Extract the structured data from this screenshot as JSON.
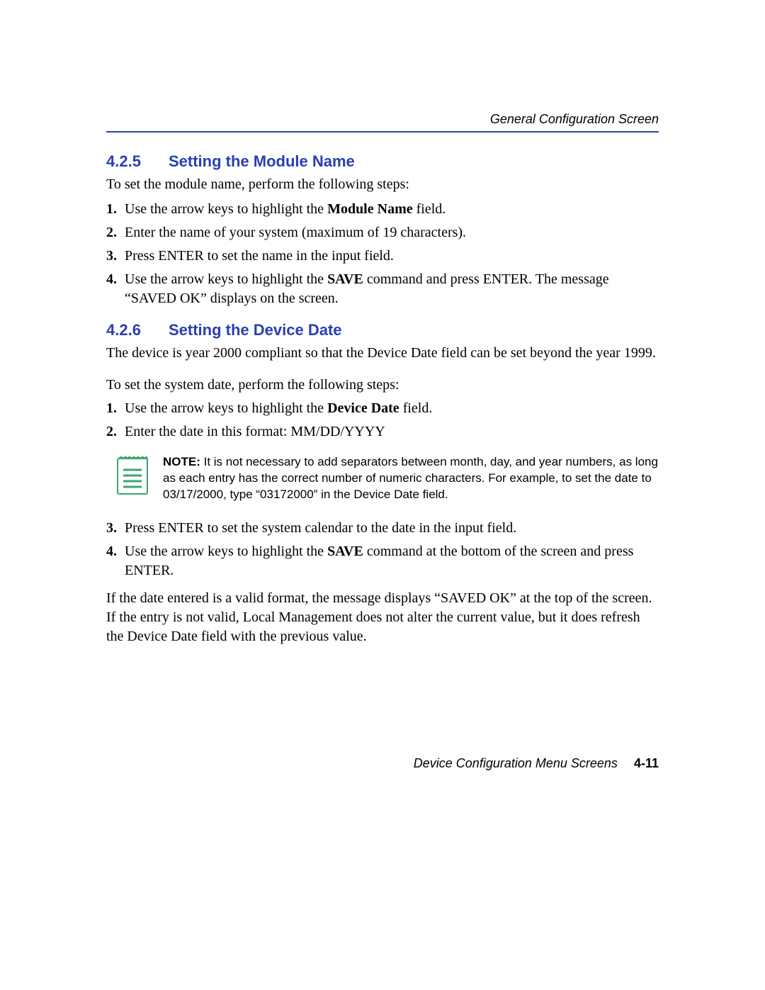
{
  "header": "General Configuration Screen",
  "section1": {
    "number": "4.2.5",
    "title": "Setting the Module Name",
    "intro": "To set the module name, perform the following steps:",
    "steps": {
      "s1_a": "Use the arrow keys to highlight the ",
      "s1_bold": "Module Name",
      "s1_b": " field.",
      "s2": "Enter the name of your system (maximum of 19 characters).",
      "s3": "Press ENTER to set the name in the input field.",
      "s4_a": "Use the arrow keys to highlight the ",
      "s4_bold": "SAVE",
      "s4_b": " command and press ENTER. The message “SAVED OK” displays on the screen."
    }
  },
  "section2": {
    "number": "4.2.6",
    "title": "Setting the Device Date",
    "intro1": "The device is year 2000 compliant so that the Device Date field can be set beyond the year 1999.",
    "intro2": "To set the system date, perform the following steps:",
    "stepsA": {
      "s1_a": "Use the arrow keys to highlight the ",
      "s1_bold": "Device Date",
      "s1_b": " field.",
      "s2": "Enter the date in this format: MM/DD/YYYY"
    },
    "note_label": "NOTE:",
    "note_text": " It is not necessary to add separators between month, day, and year numbers, as long as each entry has the correct number of numeric characters. For example, to set the date to 03/17/2000, type “03172000” in the Device Date field.",
    "stepsB": {
      "s3": "Press ENTER to set the system calendar to the date in the input field.",
      "s4_a": "Use the arrow keys to highlight the ",
      "s4_bold": "SAVE",
      "s4_b": " command at the bottom of the screen and press ENTER."
    },
    "closing": "If the date entered is a valid format, the message displays “SAVED OK” at the top of the screen. If the entry is not valid, Local Management does not alter the current value, but it does refresh the Device Date field with the previous value."
  },
  "footer": {
    "text": "Device Configuration Menu Screens",
    "page": "4-11"
  },
  "markers": {
    "m1": "1.",
    "m2": "2.",
    "m3": "3.",
    "m4": "4."
  }
}
